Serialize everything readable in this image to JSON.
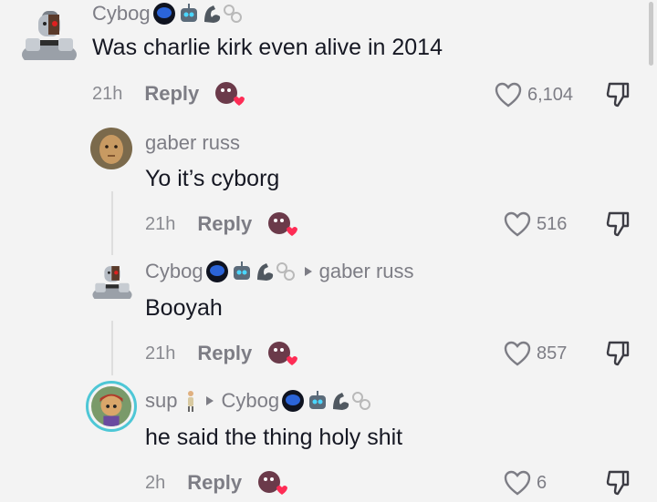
{
  "comments": [
    {
      "username": "Cybog",
      "text": "Was charlie kirk even alive in 2014",
      "time": "21h",
      "reply_label": "Reply",
      "likes": "6,104"
    },
    {
      "username": "gaber russ",
      "text": "Yo it’s cyborg",
      "time": "21h",
      "reply_label": "Reply",
      "likes": "516"
    },
    {
      "username": "Cybog",
      "reply_to": "gaber russ",
      "text": "Booyah",
      "time": "21h",
      "reply_label": "Reply",
      "likes": "857"
    },
    {
      "username": "sup",
      "reply_to": "Cybog",
      "text": "he said the thing holy shit",
      "time": "2h",
      "reply_label": "Reply",
      "likes": "6"
    }
  ],
  "colors": {
    "background": "#f3f3f3",
    "text": "#161823",
    "muted": "#7d7d85",
    "heart_badge": "#fe2c55"
  },
  "icons": [
    "heart-outline-icon",
    "thumbs-down-icon",
    "creator-liked-icon",
    "eight-ball-badge",
    "robot-badge",
    "flexed-arm-badge",
    "cuffs-badge",
    "person-badge"
  ]
}
